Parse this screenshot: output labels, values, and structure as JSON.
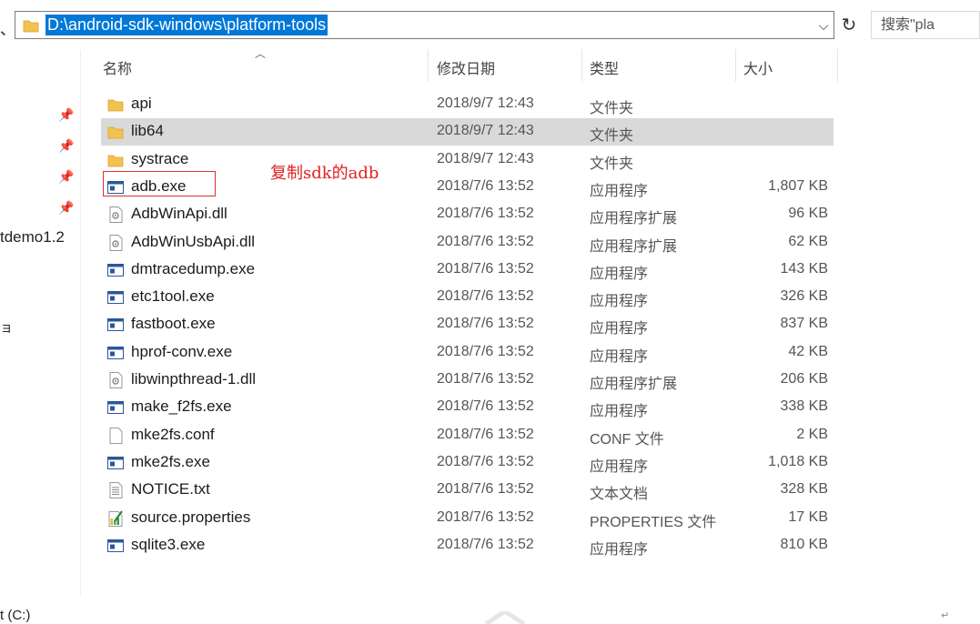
{
  "address": {
    "path": "D:\\android-sdk-windows\\platform-tools",
    "dropdown_icon": "chevron-down-icon",
    "refresh_icon": "refresh-icon",
    "refresh_glyph": "↻"
  },
  "search": {
    "text": "搜索\"pla"
  },
  "left_pane": {
    "frag_top": "、",
    "frag_mid": "tdemo1.2",
    "frag_small": "ョ",
    "frag_bottom": "t (C:)"
  },
  "columns": {
    "name": "名称",
    "date": "修改日期",
    "type": "类型",
    "size": "大小"
  },
  "annotation": {
    "text": "复制sdk的adb"
  },
  "files": [
    {
      "name": "api",
      "date": "2018/9/7 12:43",
      "type": "文件夹",
      "size": "",
      "icon": "folder"
    },
    {
      "name": "lib64",
      "date": "2018/9/7 12:43",
      "type": "文件夹",
      "size": "",
      "icon": "folder",
      "selected": true
    },
    {
      "name": "systrace",
      "date": "2018/9/7 12:43",
      "type": "文件夹",
      "size": "",
      "icon": "folder"
    },
    {
      "name": "adb.exe",
      "date": "2018/7/6 13:52",
      "type": "应用程序",
      "size": "1,807 KB",
      "icon": "exe"
    },
    {
      "name": "AdbWinApi.dll",
      "date": "2018/7/6 13:52",
      "type": "应用程序扩展",
      "size": "96 KB",
      "icon": "dll"
    },
    {
      "name": "AdbWinUsbApi.dll",
      "date": "2018/7/6 13:52",
      "type": "应用程序扩展",
      "size": "62 KB",
      "icon": "dll"
    },
    {
      "name": "dmtracedump.exe",
      "date": "2018/7/6 13:52",
      "type": "应用程序",
      "size": "143 KB",
      "icon": "exe"
    },
    {
      "name": "etc1tool.exe",
      "date": "2018/7/6 13:52",
      "type": "应用程序",
      "size": "326 KB",
      "icon": "exe"
    },
    {
      "name": "fastboot.exe",
      "date": "2018/7/6 13:52",
      "type": "应用程序",
      "size": "837 KB",
      "icon": "exe"
    },
    {
      "name": "hprof-conv.exe",
      "date": "2018/7/6 13:52",
      "type": "应用程序",
      "size": "42 KB",
      "icon": "exe"
    },
    {
      "name": "libwinpthread-1.dll",
      "date": "2018/7/6 13:52",
      "type": "应用程序扩展",
      "size": "206 KB",
      "icon": "dll"
    },
    {
      "name": "make_f2fs.exe",
      "date": "2018/7/6 13:52",
      "type": "应用程序",
      "size": "338 KB",
      "icon": "exe"
    },
    {
      "name": "mke2fs.conf",
      "date": "2018/7/6 13:52",
      "type": "CONF 文件",
      "size": "2 KB",
      "icon": "file"
    },
    {
      "name": "mke2fs.exe",
      "date": "2018/7/6 13:52",
      "type": "应用程序",
      "size": "1,018 KB",
      "icon": "exe"
    },
    {
      "name": "NOTICE.txt",
      "date": "2018/7/6 13:52",
      "type": "文本文档",
      "size": "328 KB",
      "icon": "txt"
    },
    {
      "name": "source.properties",
      "date": "2018/7/6 13:52",
      "type": "PROPERTIES 文件",
      "size": "17 KB",
      "icon": "properties"
    },
    {
      "name": "sqlite3.exe",
      "date": "2018/7/6 13:52",
      "type": "应用程序",
      "size": "810 KB",
      "icon": "exe"
    }
  ],
  "colors": {
    "selection": "#0078d7",
    "row_selected": "#d9d9d9",
    "annotation": "#e02020",
    "folder": "#f2c14e"
  },
  "icons": {
    "pin": "pin-icon",
    "sort": "sort-up-icon"
  }
}
